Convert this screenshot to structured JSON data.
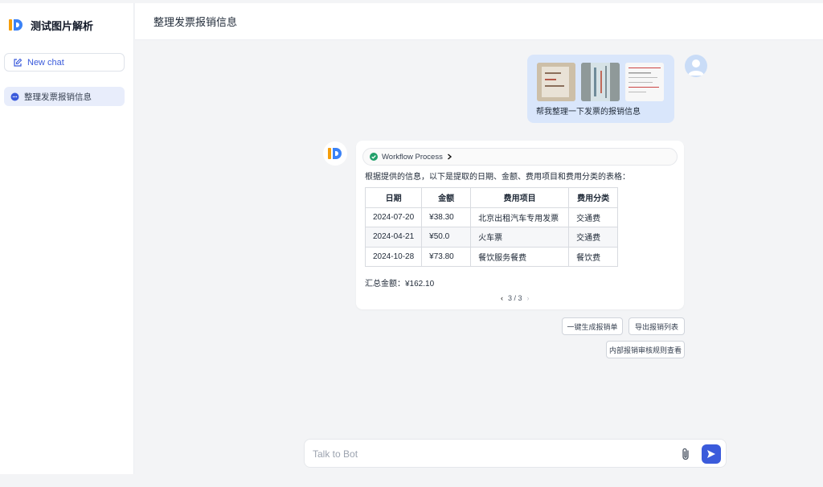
{
  "app": {
    "title": "测试图片解析"
  },
  "sidebar": {
    "new_chat_label": "New chat",
    "conversations": [
      {
        "label": "整理发票报销信息",
        "active": true
      }
    ]
  },
  "header": {
    "title": "整理发票报销信息"
  },
  "user_message": {
    "text": "帮我整理一下发票的报销信息",
    "attachments": [
      "image",
      "image",
      "image"
    ]
  },
  "bot_message": {
    "workflow_label": "Workflow Process",
    "intro": "根据提供的信息，以下是提取的日期、金额、费用项目和费用分类的表格：",
    "table": {
      "headers": [
        "日期",
        "金额",
        "费用项目",
        "费用分类"
      ],
      "rows": [
        [
          "2024-07-20",
          "¥38.30",
          "北京出租汽车专用发票",
          "交通费"
        ],
        [
          "2024-04-21",
          "¥50.0",
          "火车票",
          "交通费"
        ],
        [
          "2024-10-28",
          "¥73.80",
          "餐饮服务餐费",
          "餐饮费"
        ]
      ]
    },
    "summary": "汇总金额：¥162.10",
    "pager": {
      "prev": "‹",
      "text": "3 / 3",
      "next": "›"
    }
  },
  "actions": [
    "一键生成报销单",
    "导出报销列表",
    "内部报销审核规则查看"
  ],
  "composer": {
    "placeholder": "Talk to Bot"
  },
  "colors": {
    "accent": "#3b5bdb",
    "user_bubble": "#d9e6fb",
    "success": "#22a06b"
  }
}
